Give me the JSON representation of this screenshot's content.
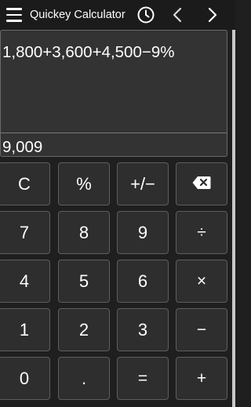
{
  "toolbar": {
    "title": "Quickey Calculator",
    "icons": [
      "menu-icon",
      "history-icon",
      "back-icon",
      "forward-icon"
    ]
  },
  "display": {
    "expression": "1,800+3,600+4,500−9%",
    "result": "9,009"
  },
  "keypad": {
    "rows": [
      [
        "C",
        "%",
        "+/−",
        "backspace"
      ],
      [
        "7",
        "8",
        "9",
        "÷"
      ],
      [
        "4",
        "5",
        "6",
        "×"
      ],
      [
        "1",
        "2",
        "3",
        "−"
      ],
      [
        "0",
        ".",
        "=",
        "+"
      ]
    ]
  },
  "colors": {
    "background": "#1f1f1f",
    "key_background": "#2e2e2e",
    "key_border": "#5e5e5e",
    "display_background": "#333333",
    "text": "#ffffff"
  }
}
